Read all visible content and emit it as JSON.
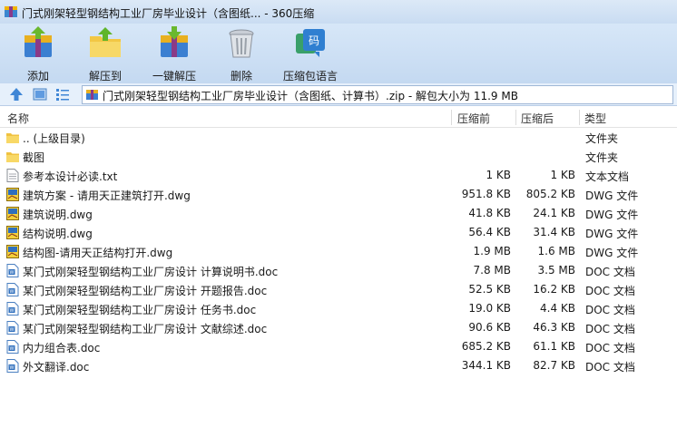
{
  "window": {
    "title": "门式刚架轻型钢结构工业厂房毕业设计（含图纸... - 360压缩"
  },
  "toolbar": {
    "add": "添加",
    "extract_to": "解压到",
    "one_click_extract": "一键解压",
    "delete": "删除",
    "language_pack": "压缩包语言"
  },
  "address": {
    "path": "门式刚架轻型钢结构工业厂房毕业设计（含图纸、计算书）.zip - 解包大小为 11.9 MB"
  },
  "columns": {
    "name": "名称",
    "size": "压缩前",
    "compressed": "压缩后",
    "type": "类型"
  },
  "files": [
    {
      "name": ".. (上级目录)",
      "size": "",
      "compressed": "",
      "type": "文件夹",
      "icon": "folder-icon"
    },
    {
      "name": "截图",
      "size": "",
      "compressed": "",
      "type": "文件夹",
      "icon": "folder-icon"
    },
    {
      "name": "参考本设计必读.txt",
      "size": "1 KB",
      "compressed": "1 KB",
      "type": "文本文档",
      "icon": "txt-file-icon"
    },
    {
      "name": "建筑方案 - 请用天正建筑打开.dwg",
      "size": "951.8 KB",
      "compressed": "805.2 KB",
      "type": "DWG 文件",
      "icon": "dwg-file-icon"
    },
    {
      "name": "建筑说明.dwg",
      "size": "41.8 KB",
      "compressed": "24.1 KB",
      "type": "DWG 文件",
      "icon": "dwg-file-icon"
    },
    {
      "name": "结构说明.dwg",
      "size": "56.4 KB",
      "compressed": "31.4 KB",
      "type": "DWG 文件",
      "icon": "dwg-file-icon"
    },
    {
      "name": "结构图-请用天正结构打开.dwg",
      "size": "1.9 MB",
      "compressed": "1.6 MB",
      "type": "DWG 文件",
      "icon": "dwg-file-icon"
    },
    {
      "name": "某门式刚架轻型钢结构工业厂房设计 计算说明书.doc",
      "size": "7.8 MB",
      "compressed": "3.5 MB",
      "type": "DOC 文档",
      "icon": "doc-file-icon"
    },
    {
      "name": "某门式刚架轻型钢结构工业厂房设计 开题报告.doc",
      "size": "52.5 KB",
      "compressed": "16.2 KB",
      "type": "DOC 文档",
      "icon": "doc-file-icon"
    },
    {
      "name": "某门式刚架轻型钢结构工业厂房设计 任务书.doc",
      "size": "19.0 KB",
      "compressed": "4.4 KB",
      "type": "DOC 文档",
      "icon": "doc-file-icon"
    },
    {
      "name": "某门式刚架轻型钢结构工业厂房设计 文献综述.doc",
      "size": "90.6 KB",
      "compressed": "46.3 KB",
      "type": "DOC 文档",
      "icon": "doc-file-icon"
    },
    {
      "name": "内力组合表.doc",
      "size": "685.2 KB",
      "compressed": "61.1 KB",
      "type": "DOC 文档",
      "icon": "doc-file-icon"
    },
    {
      "name": "外文翻译.doc",
      "size": "344.1 KB",
      "compressed": "82.7 KB",
      "type": "DOC 文档",
      "icon": "doc-file-icon"
    }
  ]
}
